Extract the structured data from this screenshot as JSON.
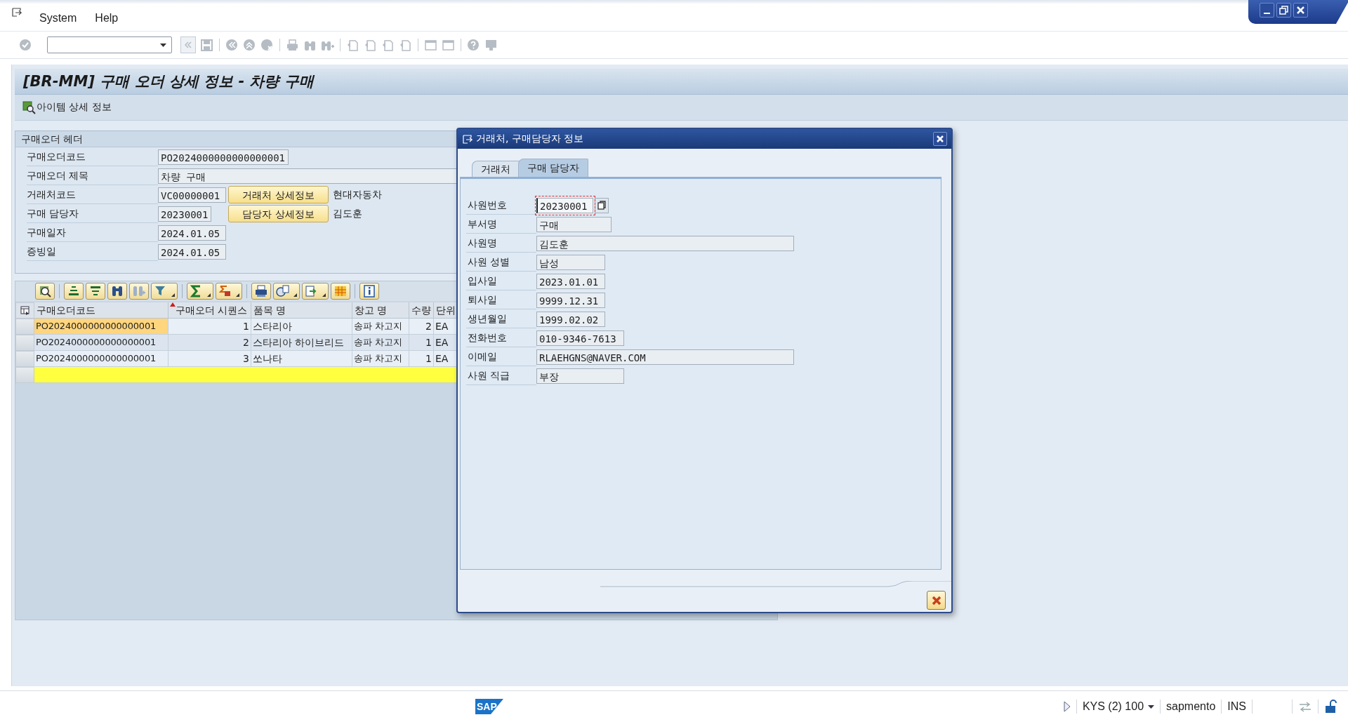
{
  "menu_bar": {
    "items": [
      {
        "label": "System"
      },
      {
        "label": "Help"
      }
    ]
  },
  "screen_title": "[BR-MM] 구매 오더 상세 정보 - 차량 구매",
  "app_toolbar": {
    "buttons": [
      {
        "label": "아이템 상세 정보"
      }
    ]
  },
  "header_group": {
    "title": "구매오더 헤더",
    "fields": [
      {
        "label": "구매오더코드",
        "value": "PO2024000000000000001"
      },
      {
        "label": "구매오더 제목",
        "value": "차량 구매"
      },
      {
        "label": "거래처코드",
        "value": "VC00000001",
        "button": "거래처 상세정보",
        "description": "현대자동차"
      },
      {
        "label": "구매 담당자",
        "value": "20230001",
        "button": "담당자 상세정보",
        "description": "김도훈"
      },
      {
        "label": "구매일자",
        "value": "2024.01.05"
      },
      {
        "label": "증빙일",
        "value": "2024.01.05"
      }
    ]
  },
  "item_table": {
    "columns": [
      {
        "label": "구매오더코드",
        "sorted": false
      },
      {
        "label": "구매오더 시퀀스",
        "sorted": true
      },
      {
        "label": "품목 명",
        "sorted": false
      },
      {
        "label": "창고 명",
        "sorted": false
      },
      {
        "label": "수량",
        "sorted": false
      },
      {
        "label": "단위",
        "sorted": false
      }
    ],
    "rows": [
      {
        "selected": true,
        "cells": [
          "PO2024000000000000001",
          "1",
          "스타리아",
          "송파 차고지",
          "2",
          "EA"
        ]
      },
      {
        "selected": false,
        "cells": [
          "PO2024000000000000001",
          "2",
          "스타리아 하이브리드",
          "송파 차고지",
          "1",
          "EA"
        ]
      },
      {
        "selected": false,
        "cells": [
          "PO2024000000000000001",
          "3",
          "쏘나타",
          "송파 차고지",
          "1",
          "EA"
        ]
      }
    ]
  },
  "dialog": {
    "title": "거래처, 구매담당자 정보",
    "tabs": [
      {
        "label": "거래처",
        "selected": false
      },
      {
        "label": "구매 담당자",
        "selected": true
      }
    ],
    "fields": [
      {
        "label": "사원번호",
        "value": "20230001",
        "focused": true
      },
      {
        "label": "부서명",
        "value": "구매",
        "focused": false
      },
      {
        "label": "사원명",
        "value": "김도훈",
        "focused": false
      },
      {
        "label": "사원 성별",
        "value": "남성",
        "focused": false
      },
      {
        "label": "입사일",
        "value": "2023.01.01",
        "focused": false
      },
      {
        "label": "퇴사일",
        "value": "9999.12.31",
        "focused": false
      },
      {
        "label": "생년월일",
        "value": "1999.02.02",
        "focused": false
      },
      {
        "label": "전화번호",
        "value": "010-9346-7613",
        "focused": false
      },
      {
        "label": "이메일",
        "value": "RLAEHGNS@NAVER.COM",
        "focused": false
      },
      {
        "label": "사원 직급",
        "value": "부장",
        "focused": false
      }
    ]
  },
  "status_bar": {
    "logo": "SAP",
    "system": "KYS (2) 100",
    "server": "sapmento",
    "mode": "INS"
  }
}
